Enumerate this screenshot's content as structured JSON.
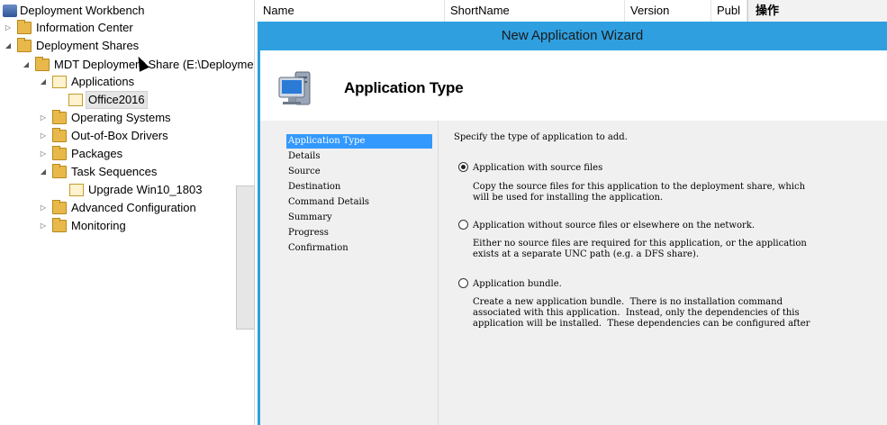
{
  "tree": {
    "root": "Deployment Workbench",
    "items": [
      {
        "label": "Information Center"
      },
      {
        "label": "Deployment Shares"
      },
      {
        "label": "MDT Deployment Share (E:\\Deployme"
      },
      {
        "label": "Applications"
      },
      {
        "label": "Office2016"
      },
      {
        "label": "Operating Systems"
      },
      {
        "label": "Out-of-Box Drivers"
      },
      {
        "label": "Packages"
      },
      {
        "label": "Task Sequences"
      },
      {
        "label": "Upgrade Win10_1803"
      },
      {
        "label": "Advanced Configuration"
      },
      {
        "label": "Monitoring"
      }
    ]
  },
  "list": {
    "columns": [
      "Name",
      "ShortName",
      "Version",
      "Publ"
    ],
    "actions_label": "操作"
  },
  "wizard": {
    "title": "New Application Wizard",
    "page_title": "Application Type",
    "steps": [
      "Application Type",
      "Details",
      "Source",
      "Destination",
      "Command Details",
      "Summary",
      "Progress",
      "Confirmation"
    ],
    "prompt": "Specify the type of application to add.",
    "options": [
      {
        "label": "Application with source files",
        "selected": true,
        "desc_lines": [
          "Copy the source files for this application to the deployment share, which",
          "will be used for installing the application."
        ]
      },
      {
        "label": "Application without source files or elsewhere on the network.",
        "selected": false,
        "desc_lines": [
          "Either no source files are required for this application, or the application",
          "exists at a separate UNC path (e.g. a DFS share)."
        ]
      },
      {
        "label": "Application bundle.",
        "selected": false,
        "desc_lines": [
          "Create a new application bundle.  There is no installation command",
          "associated with this application.  Instead, only the dependencies of this",
          "application will be installed.  These dependencies can be configured after"
        ]
      }
    ]
  },
  "colors": {
    "wizard_frame": "#2f9fe0",
    "step_highlight": "#3399ff",
    "folder": "#e8b84a"
  }
}
